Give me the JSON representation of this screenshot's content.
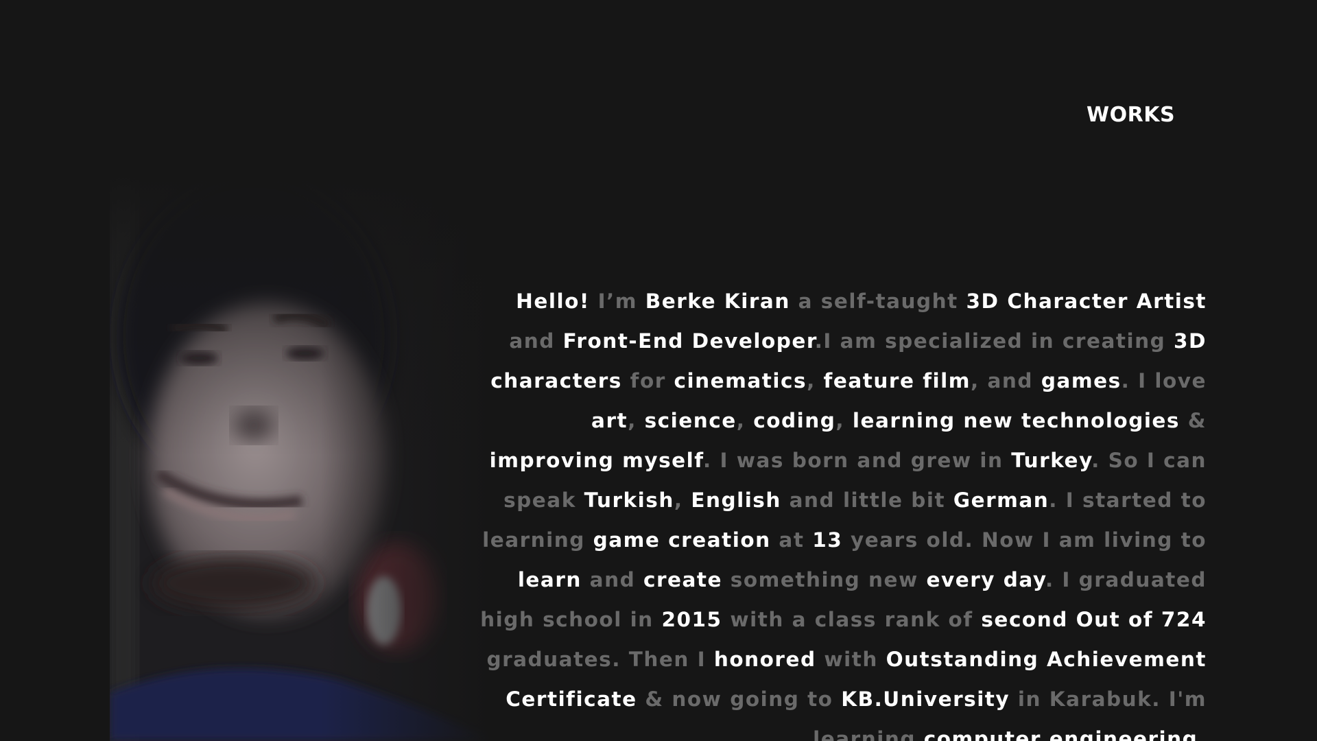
{
  "nav": {
    "works_label": "WORKS"
  },
  "portrait": {
    "icon": "profile-photo"
  },
  "bio": {
    "segments": [
      {
        "t": "Hello!",
        "hl": true
      },
      {
        "t": " I’m ",
        "hl": false
      },
      {
        "t": "Berke Kiran",
        "hl": true
      },
      {
        "t": " a self-taught ",
        "hl": false
      },
      {
        "t": "3D Character Artist",
        "hl": true
      },
      {
        "t": " and ",
        "hl": false
      },
      {
        "t": "Front-End Developer",
        "hl": true
      },
      {
        "t": ".I am specialized in creating ",
        "hl": false
      },
      {
        "t": "3D characters",
        "hl": true
      },
      {
        "t": " for ",
        "hl": false
      },
      {
        "t": "cinematics",
        "hl": true
      },
      {
        "t": ", ",
        "hl": false
      },
      {
        "t": "feature film",
        "hl": true
      },
      {
        "t": ", and ",
        "hl": false
      },
      {
        "t": "games",
        "hl": true
      },
      {
        "t": ". I love ",
        "hl": false
      },
      {
        "t": "art",
        "hl": true
      },
      {
        "t": ", ",
        "hl": false
      },
      {
        "t": "science",
        "hl": true
      },
      {
        "t": ", ",
        "hl": false
      },
      {
        "t": "coding",
        "hl": true
      },
      {
        "t": ", ",
        "hl": false
      },
      {
        "t": "learning new technologies",
        "hl": true
      },
      {
        "t": " & ",
        "hl": false
      },
      {
        "t": "improving myself",
        "hl": true
      },
      {
        "t": ". I was born and grew in ",
        "hl": false
      },
      {
        "t": "Turkey",
        "hl": true
      },
      {
        "t": ". So I can speak ",
        "hl": false
      },
      {
        "t": "Turkish",
        "hl": true
      },
      {
        "t": ", ",
        "hl": false
      },
      {
        "t": "English",
        "hl": true
      },
      {
        "t": " and little bit ",
        "hl": false
      },
      {
        "t": "German",
        "hl": true
      },
      {
        "t": ". I started to learning ",
        "hl": false
      },
      {
        "t": "game creation",
        "hl": true
      },
      {
        "t": " at ",
        "hl": false
      },
      {
        "t": "13",
        "hl": true
      },
      {
        "t": " years old. Now I am living to ",
        "hl": false
      },
      {
        "t": "learn",
        "hl": true
      },
      {
        "t": " and ",
        "hl": false
      },
      {
        "t": "create",
        "hl": true
      },
      {
        "t": " something new ",
        "hl": false
      },
      {
        "t": "every day",
        "hl": true
      },
      {
        "t": ". I graduated high school in ",
        "hl": false
      },
      {
        "t": "2015",
        "hl": true
      },
      {
        "t": " with a class rank of ",
        "hl": false
      },
      {
        "t": "second Out of 724",
        "hl": true
      },
      {
        "t": " graduates. Then I ",
        "hl": false
      },
      {
        "t": "honored",
        "hl": true
      },
      {
        "t": " with ",
        "hl": false
      },
      {
        "t": "Outstanding Achievement Certificate",
        "hl": true
      },
      {
        "t": " & now going to ",
        "hl": false
      },
      {
        "t": "KB.University",
        "hl": true
      },
      {
        "t": " in Karabuk. I'm learning ",
        "hl": false
      },
      {
        "t": "computer engineering",
        "hl": true
      },
      {
        "t": ".",
        "hl": false
      }
    ]
  }
}
